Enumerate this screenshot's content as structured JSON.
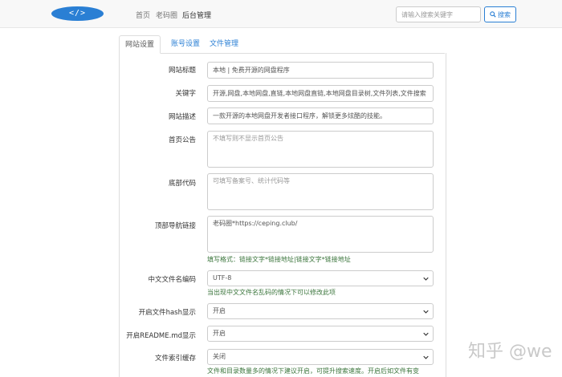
{
  "navbar": {
    "logo_text": "</>",
    "links": [
      "首页",
      "老码圈",
      "后台管理"
    ],
    "search_placeholder": "请输入搜索关键字",
    "search_label": "搜索"
  },
  "tabs": [
    "网站设置",
    "账号设置",
    "文件管理"
  ],
  "form": {
    "site_title": {
      "label": "网站标题",
      "value": "本地 | 免费开源的网盘程序"
    },
    "keywords": {
      "label": "关键字",
      "value": "开源,网盘,本地网盘,直链,本地网盘直链,本地网盘目录树,文件列表,文件搜索"
    },
    "description": {
      "label": "网站描述",
      "value": "一款开源的本地网盘开发者接口程序，解锁更多炫酷的技能。"
    },
    "announcement": {
      "label": "首页公告",
      "placeholder": "不填写则不显示首页公告"
    },
    "footer_code": {
      "label": "底部代码",
      "placeholder": "可填写备案号、统计代码等"
    },
    "nav_links": {
      "label": "顶部导航链接",
      "value": "老码圈*https://ceping.club/",
      "help": "填写格式：链接文字*链接地址|链接文字*链接地址"
    },
    "cn_encoding": {
      "label": "中文文件名编码",
      "value": "UTF-8",
      "help": "当出现中文文件名乱码的情况下可以修改此项"
    },
    "hash_display": {
      "label": "开启文件hash显示",
      "value": "开启"
    },
    "readme_display": {
      "label": "开启README.md显示",
      "value": "开启"
    },
    "index_cache": {
      "label": "文件索引缓存",
      "value": "关闭",
      "help": "文件和目录数量多的情况下建议开启，可提升搜索速度。开启后如文件有变"
    }
  },
  "watermark": "知乎 @we"
}
